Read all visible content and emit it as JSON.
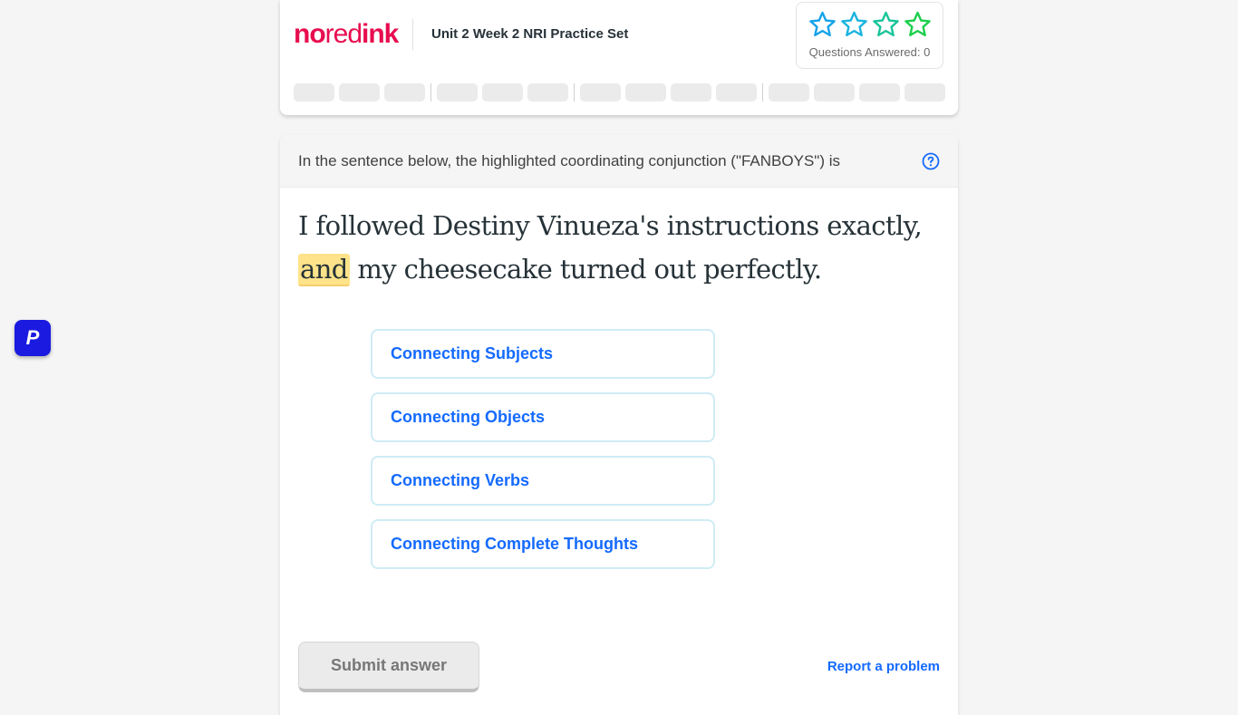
{
  "header": {
    "logo": {
      "part1": "no",
      "part2": "red",
      "part3": "ink"
    },
    "assignment_title": "Unit 2 Week 2 NRI Practice Set",
    "questions_answered": "Questions Answered: 0",
    "stars": [
      {
        "icon": "star-outline-icon",
        "color": "#16a3e9"
      },
      {
        "icon": "star-outline-icon",
        "color": "#1bb4df"
      },
      {
        "icon": "star-outline-icon",
        "color": "#19c49a"
      },
      {
        "icon": "star-outline-icon",
        "color": "#1ccf4c"
      }
    ],
    "progress_groups": [
      3,
      3,
      4,
      4
    ]
  },
  "question": {
    "prompt": "In the sentence below, the highlighted coordinating conjunction (\"FANBOYS\") is",
    "sentence_before": "I followed Destiny Vinueza's instructions exactly, ",
    "sentence_highlight": "and",
    "sentence_after": " my cheesecake turned out perfectly.",
    "choices": [
      "Connecting Subjects",
      "Connecting Objects",
      "Connecting Verbs",
      "Connecting Complete Thoughts"
    ],
    "submit_label": "Submit answer",
    "report_label": "Report a problem"
  },
  "extension": {
    "label": "P"
  },
  "colors": {
    "brand": "#e70d4f",
    "link": "#146aff",
    "highlight": "#ffe38a"
  }
}
